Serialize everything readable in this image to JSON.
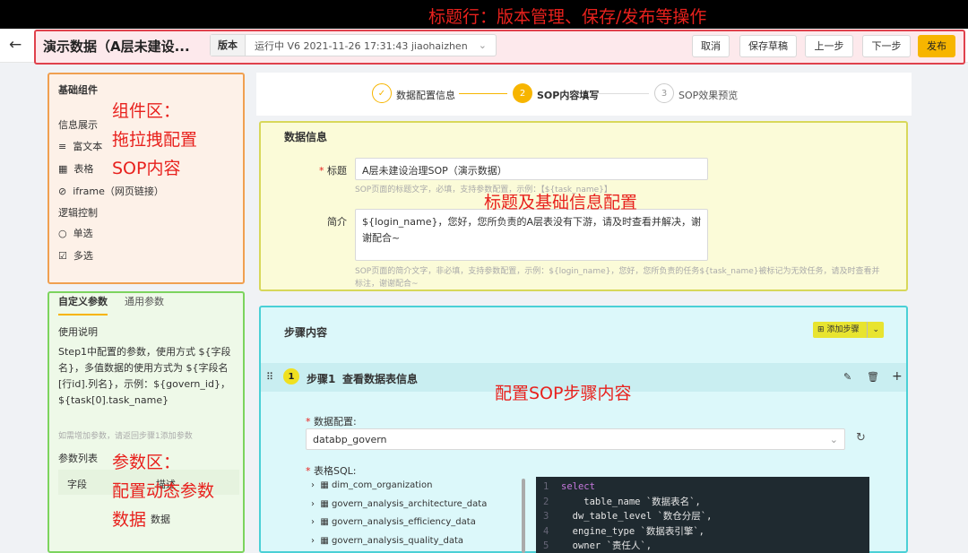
{
  "annotations": {
    "header": "标题行：版本管理、保存/发布等操作",
    "components": [
      "组件区：",
      "拖拉拽配置",
      "SOP内容"
    ],
    "title_info": "标题及基础信息配置",
    "steps": "配置SOP步骤内容",
    "params": [
      "参数区：",
      "配置动态参数",
      "数据"
    ]
  },
  "header": {
    "back_icon": "arrow-left-icon",
    "title": "演示数据（A层未建设...",
    "version_tag": "版本",
    "version_text": "运行中 V6 2021-11-26 17:31:43 jiaohaizhen",
    "buttons": {
      "cancel": "取消",
      "save_draft": "保存草稿",
      "prev": "上一步",
      "next": "下一步",
      "publish": "发布"
    }
  },
  "components": {
    "title": "基础组件",
    "group_display": "信息展示",
    "rich_text": "富文本",
    "table": "表格",
    "iframe": "iframe（网页链接）",
    "group_logic": "逻辑控制",
    "single": "单选",
    "multi": "多选"
  },
  "params": {
    "tab_custom": "自定义参数",
    "tab_common": "通用参数",
    "usage_title": "使用说明",
    "usage_text": "Step1中配置的参数，使用方式 ${字段名}，多值数据的使用方式为 ${字段名[行id].列名}，示例：${govern_id}，${task[0].task_name}",
    "add_hint": "如需增加参数，请返回步骤1添加参数",
    "list_title": "参数列表",
    "col_field": "字段",
    "col_desc": "描述",
    "row_tail": "数据"
  },
  "stepper": {
    "s1_label": "数据配置信息",
    "s2_num": "2",
    "s2_label": "SOP内容填写",
    "s3_num": "3",
    "s3_label": "SOP效果预览"
  },
  "data_info": {
    "section_title": "数据信息",
    "required_mark": "*",
    "title_label": "标题",
    "title_value": "A层未建设治理SOP（演示数据）",
    "title_hint": "SOP页面的标题文字，必填，支持参数配置，示例：【${task_name}】",
    "intro_label": "简介",
    "intro_value": "${login_name}，您好，您所负责的A层表没有下游，请及时查看并解决，谢谢配合~",
    "intro_hint": "SOP页面的简介文字，非必填，支持参数配置，示例：${login_name}，您好，您所负责的任务${task_name}被标记为无效任务，请及时查看并标注，谢谢配合~"
  },
  "steps": {
    "section_title": "步骤内容",
    "add_step": "添加步骤",
    "step_num": "1",
    "step_label": "步骤1",
    "step_title": "查看数据表信息",
    "data_config_label": "数据配置:",
    "data_config_value": "databp_govern",
    "sql_label": "表格SQL:",
    "tree": [
      "dim_com_organization",
      "govern_analysis_architecture_data",
      "govern_analysis_efficiency_data",
      "govern_analysis_quality_data"
    ],
    "code": [
      "select",
      "    table_name `数据表名`,",
      "  dw_table_level `数仓分层`,",
      "  engine_type `数据表引擎`,",
      "  owner `责任人`,"
    ]
  },
  "colors": {
    "accent": "#f7b500",
    "red": "#e8211d"
  }
}
